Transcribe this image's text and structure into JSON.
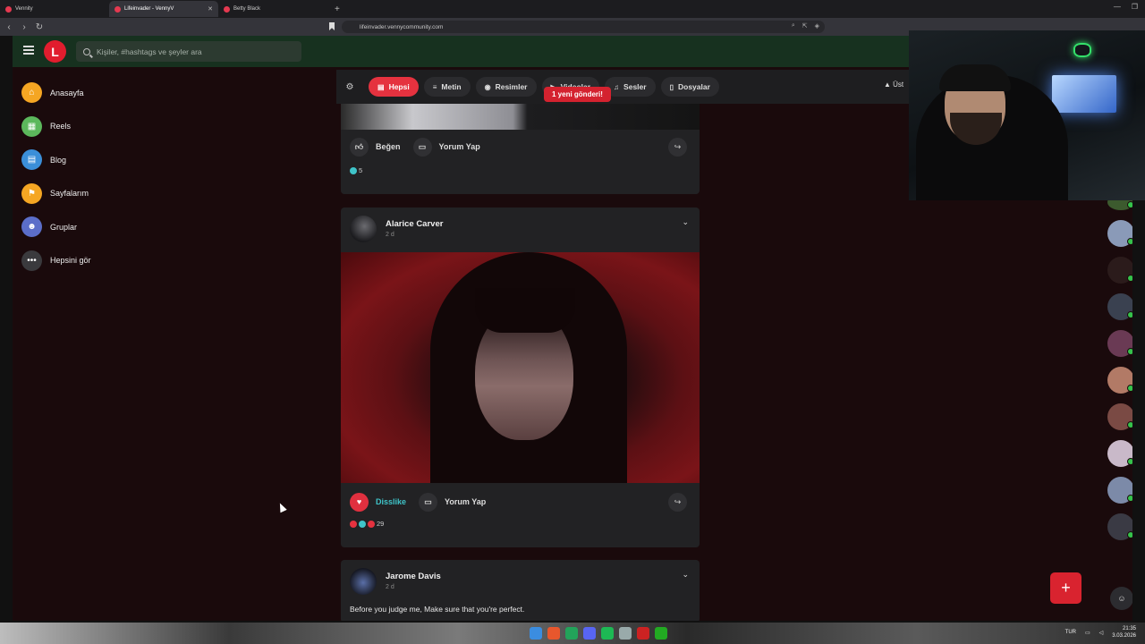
{
  "browser": {
    "tabs": [
      {
        "title": "Vennity",
        "active": false
      },
      {
        "title": "Lifeinvader - VennyV",
        "active": true
      },
      {
        "title": "Betty Black",
        "active": false
      }
    ],
    "new_tab": "+",
    "url": "lifeinvader.vennycommunity.com"
  },
  "app": {
    "logo_letter": "L",
    "search_placeholder": "Kişiler, #hashtags ve şeyler ara",
    "sidebar": [
      {
        "label": "Anasayfa",
        "icon": "home-icon",
        "color": "#f5a623"
      },
      {
        "label": "Reels",
        "icon": "reels-icon",
        "color": "#5cb85c"
      },
      {
        "label": "Blog",
        "icon": "blog-icon",
        "color": "#3b8fd9"
      },
      {
        "label": "Sayfalarım",
        "icon": "flag-icon",
        "color": "#f5a623"
      },
      {
        "label": "Gruplar",
        "icon": "groups-icon",
        "color": "#5b6ec9"
      },
      {
        "label": "Hepsini gör",
        "icon": "more-icon",
        "color": "#3a3a3d"
      }
    ],
    "filters": [
      {
        "label": "Hepsi",
        "icon": "all-icon",
        "active": true
      },
      {
        "label": "Metin",
        "icon": "text-icon",
        "active": false
      },
      {
        "label": "Resimler",
        "icon": "camera-icon",
        "active": false
      },
      {
        "label": "Videolar",
        "icon": "video-icon",
        "active": false
      },
      {
        "label": "Sesler",
        "icon": "music-icon",
        "active": false
      },
      {
        "label": "Dosyalar",
        "icon": "file-icon",
        "active": false
      }
    ],
    "new_post_toast": "1 yeni gönderi!",
    "scroll_top_label": "Üst",
    "posts": [
      {
        "like_label": "Beğen",
        "comment_label": "Yorum Yap",
        "reaction_count": "5"
      },
      {
        "author": "Alarice Carver",
        "time": "2 d",
        "like_label": "Disslike",
        "comment_label": "Yorum Yap",
        "reaction_count": "29"
      },
      {
        "author": "Jarome Davis",
        "time": "2 d",
        "text": "Before you judge me, Make sure that you're perfect."
      }
    ],
    "fab_label": "+",
    "accent_color": "#e5323f"
  },
  "taskbar": {
    "language": "TUR",
    "time": "21:35",
    "date": "3.03.2026"
  }
}
